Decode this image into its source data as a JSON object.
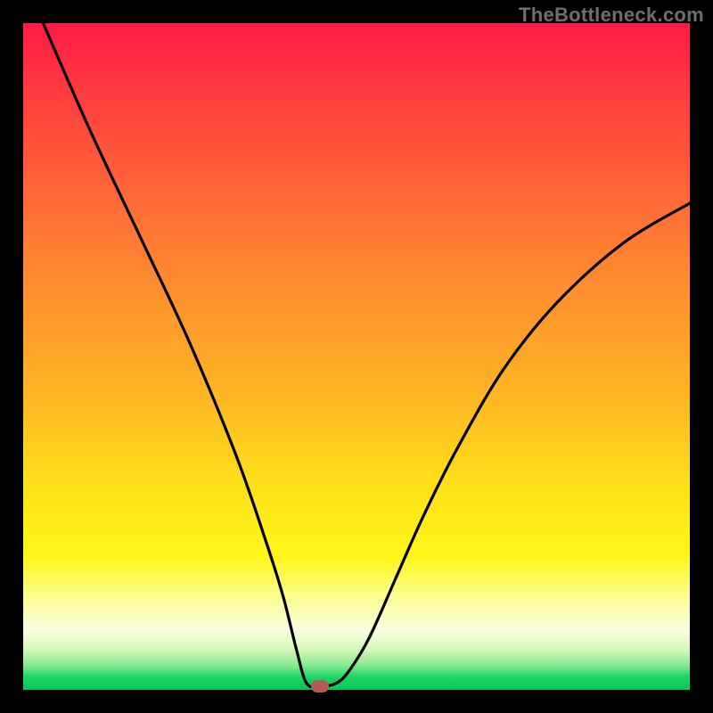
{
  "watermark": "TheBottleneck.com",
  "chart_data": {
    "type": "line",
    "title": "",
    "xlabel": "",
    "ylabel": "",
    "xlim": [
      0,
      100
    ],
    "ylim": [
      0,
      100
    ],
    "grid": false,
    "legend": null,
    "series": [
      {
        "name": "bottleneck-curve",
        "x": [
          3,
          10,
          18,
          25,
          32,
          36.5,
          39,
          41,
          42.5,
          44.5,
          47,
          49,
          52,
          56,
          60,
          65,
          72,
          80,
          90,
          100
        ],
        "y": [
          100,
          84,
          67,
          52,
          35,
          22,
          14,
          6,
          1,
          0.5,
          1,
          3,
          8,
          17,
          26,
          36,
          48,
          58,
          67,
          73
        ]
      }
    ],
    "marker": {
      "x": 44.5,
      "y": 0.5,
      "color": "#b65a56"
    },
    "background_gradient": {
      "top": "#ff1a47",
      "mid": "#ffe21a",
      "bottom": "#06c659"
    }
  }
}
